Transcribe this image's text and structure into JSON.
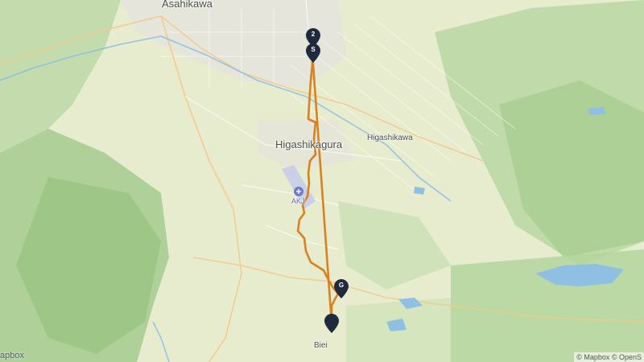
{
  "map": {
    "places": {
      "asahikawa": "Asahikawa",
      "higashikagura": "Higashikagura",
      "higashikawa": "Higashikawa",
      "biei": "Biei",
      "airport_code": "AKJ"
    },
    "markers": [
      {
        "label": "2"
      },
      {
        "label": "S"
      },
      {
        "label": "G"
      },
      {
        "label": ""
      }
    ],
    "route_color": "#d9811e",
    "marker_color": "#1f2a3c",
    "water_color": "#8fbfe3",
    "attribution": "© Mapbox © OpenS",
    "logo": "apbox"
  }
}
